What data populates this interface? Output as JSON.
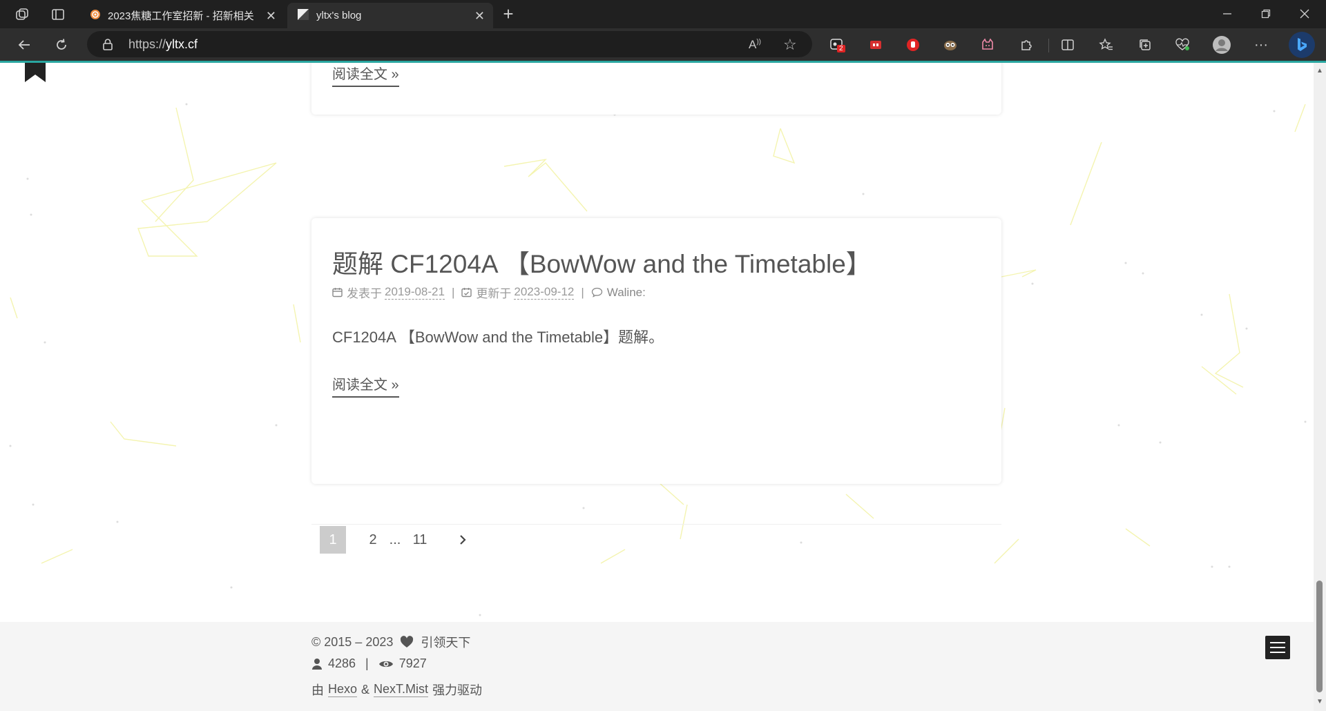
{
  "browser": {
    "tabs": [
      {
        "title": "2023焦糖工作室招新 - 招新相关",
        "active": false,
        "icon": "caramel-studio-favicon"
      },
      {
        "title": "yltx's blog",
        "active": true,
        "icon": "blog-favicon"
      }
    ],
    "url": {
      "scheme": "https://",
      "host": "yltx.cf"
    },
    "extension_badge": "2"
  },
  "page": {
    "read_more_label": "阅读全文 »",
    "post": {
      "title": "题解 CF1204A 【BowWow and the Timetable】",
      "posted_label": "发表于",
      "posted_date": "2019-08-21",
      "updated_label": "更新于",
      "updated_date": "2023-09-12",
      "comments_label": "Waline:",
      "excerpt": "CF1204A 【BowWow and the Timetable】题解。",
      "read_more_label": "阅读全文 »"
    },
    "pagination": {
      "current": "1",
      "pages": [
        "2",
        "...",
        "11"
      ],
      "next_icon": "chevron-right-icon"
    }
  },
  "footer": {
    "copyright": "© 2015 – 2023",
    "author": "引领天下",
    "visitors": "4286",
    "views": "7927",
    "powered_prefix": "由",
    "hexo": "Hexo",
    "amp": "&",
    "theme": "NexT.Mist",
    "powered_suffix": "强力驱动"
  },
  "colors": {
    "accent": "#29a6a0",
    "background_lines": "#f3f3a0",
    "text": "#555555"
  }
}
